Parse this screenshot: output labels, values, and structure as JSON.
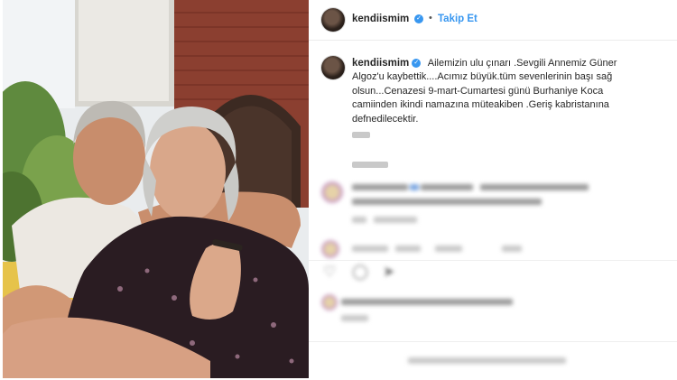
{
  "post": {
    "username": "kendiismim",
    "follow_label": "Takip Et",
    "separator": "•",
    "caption": "Ailemizin ulu çınarı .Sevgili Annemiz Güner Algoz'u kaybettik....Acımız büyük.tüm sevenlerinin başı sağ olsun...Cenazesi 9-mart-Cumartesi günü Burhaniye Koca camiinden ikindi namazına müteakiben .Geriş kabristanına defnedilecektir."
  },
  "icons": {
    "verified": "verified-badge-icon",
    "like": "heart-icon",
    "comment": "comment-icon",
    "share": "share-icon"
  },
  "colors": {
    "accent": "#3897f0",
    "text": "#262626",
    "muted": "#8e8e8e"
  }
}
